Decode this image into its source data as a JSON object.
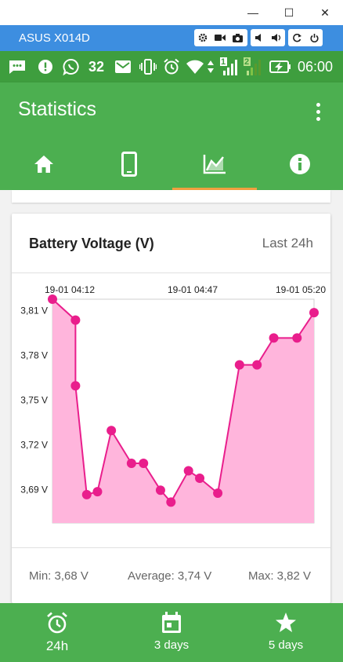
{
  "window": {
    "minimize_glyph": "—",
    "maximize_glyph": "☐",
    "close_glyph": "✕"
  },
  "emulator": {
    "device_name": "ASUS X014D"
  },
  "status_bar": {
    "notification_count": "32",
    "time": "06:00",
    "sim1": "1",
    "sim2": "2"
  },
  "app_bar": {
    "title": "Statistics",
    "tabs": [
      "home-icon",
      "phone-icon",
      "chart-icon",
      "info-icon"
    ],
    "selected_tab": 2
  },
  "card": {
    "title": "Battery Voltage (V)",
    "period": "Last 24h"
  },
  "chart_data": {
    "type": "area",
    "x_tick_labels": [
      "19-01 04:12",
      "19-01 04:47",
      "19-01 05:20"
    ],
    "y_tick_labels": [
      "3,81 V",
      "3,78 V",
      "3,75 V",
      "3,72 V",
      "3,69 V"
    ],
    "y_ticks": [
      3.81,
      3.78,
      3.75,
      3.72,
      3.69
    ],
    "ylim": [
      3.667,
      3.817
    ],
    "values": [
      3.817,
      3.803,
      3.759,
      3.686,
      3.688,
      3.729,
      3.707,
      3.707,
      3.689,
      3.681,
      3.702,
      3.697,
      3.687,
      3.773,
      3.773,
      3.791,
      3.791,
      3.808
    ],
    "series_color": "#e91e8c",
    "fill_color": "#ffb5dc"
  },
  "stats": {
    "min": "Min: 3,68 V",
    "average": "Average: 3,74 V",
    "max": "Max: 3,82 V"
  },
  "bottom_nav": [
    {
      "label": "24h",
      "icon": "alarm-clock-icon"
    },
    {
      "label": "3 days",
      "icon": "calendar-icon"
    },
    {
      "label": "5 days",
      "icon": "star-icon"
    }
  ],
  "colors": {
    "primary": "#4caf50",
    "status_bar": "#3e9e3e",
    "emulator_bar": "#3d8ee0",
    "tab_indicator": "#f0a040"
  }
}
